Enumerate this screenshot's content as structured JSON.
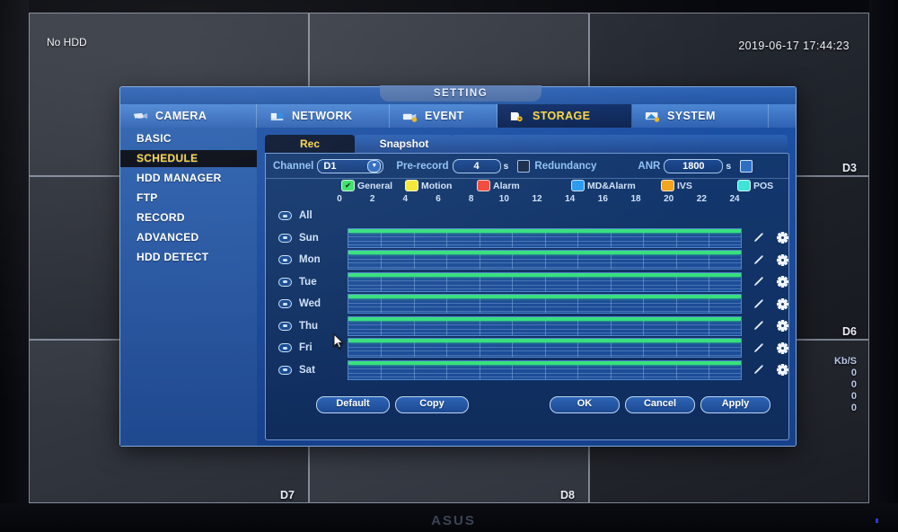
{
  "osd": {
    "no_hdd": "No HDD",
    "datetime": "2019-06-17 17:44:23",
    "channels": {
      "d3": "D3",
      "d6": "D6",
      "d7": "D7",
      "d8": "D8"
    },
    "bitrate_label": "Kb/S",
    "bitrate_values": [
      "0",
      "0",
      "0",
      "0"
    ],
    "monitor_brand": "ASUS"
  },
  "dialog": {
    "title": "SETTING",
    "nav_tabs": [
      {
        "label": "CAMERA",
        "icon": "camera-icon",
        "active": false
      },
      {
        "label": "NETWORK",
        "icon": "network-icon",
        "active": false
      },
      {
        "label": "EVENT",
        "icon": "event-icon",
        "active": false
      },
      {
        "label": "STORAGE",
        "icon": "storage-icon",
        "active": true
      },
      {
        "label": "SYSTEM",
        "icon": "system-icon",
        "active": false
      }
    ],
    "sidebar": [
      {
        "label": "BASIC",
        "active": false
      },
      {
        "label": "SCHEDULE",
        "active": true
      },
      {
        "label": "HDD MANAGER",
        "active": false
      },
      {
        "label": "FTP",
        "active": false
      },
      {
        "label": "RECORD",
        "active": false
      },
      {
        "label": "ADVANCED",
        "active": false
      },
      {
        "label": "HDD DETECT",
        "active": false
      }
    ],
    "sub_tabs": [
      {
        "label": "Rec",
        "active": true
      },
      {
        "label": "Snapshot",
        "active": false
      }
    ],
    "config": {
      "channel_label": "Channel",
      "channel_value": "D1",
      "prerecord_label": "Pre-record",
      "prerecord_value": "4",
      "prerecord_unit": "s",
      "redundancy_label": "Redundancy",
      "redundancy_checked": false,
      "anr_label": "ANR",
      "anr_value": "1800",
      "anr_unit": "s",
      "anr_checked": true
    },
    "legend": [
      {
        "label": "General",
        "color": "#3fe06a",
        "checked": true
      },
      {
        "label": "Motion",
        "color": "#f5e838",
        "checked": false
      },
      {
        "label": "Alarm",
        "color": "#f04a3c",
        "checked": false
      },
      {
        "label": "MD&Alarm",
        "color": "#2a9bf0",
        "checked": false
      },
      {
        "label": "IVS",
        "color": "#f2a51e",
        "checked": false
      },
      {
        "label": "POS",
        "color": "#3fe3d8",
        "checked": false
      }
    ],
    "hour_ticks": [
      "0",
      "2",
      "4",
      "6",
      "8",
      "10",
      "12",
      "14",
      "16",
      "18",
      "20",
      "22",
      "24"
    ],
    "rows": [
      {
        "label": "All",
        "has_bar": false,
        "icons": false
      },
      {
        "label": "Sun",
        "has_bar": true,
        "icons": true
      },
      {
        "label": "Mon",
        "has_bar": true,
        "icons": true
      },
      {
        "label": "Tue",
        "has_bar": true,
        "icons": true
      },
      {
        "label": "Wed",
        "has_bar": true,
        "icons": true
      },
      {
        "label": "Thu",
        "has_bar": true,
        "icons": true
      },
      {
        "label": "Fri",
        "has_bar": true,
        "icons": true
      },
      {
        "label": "Sat",
        "has_bar": true,
        "icons": true
      }
    ],
    "buttons": {
      "default": "Default",
      "copy": "Copy",
      "ok": "OK",
      "cancel": "Cancel",
      "apply": "Apply"
    }
  }
}
